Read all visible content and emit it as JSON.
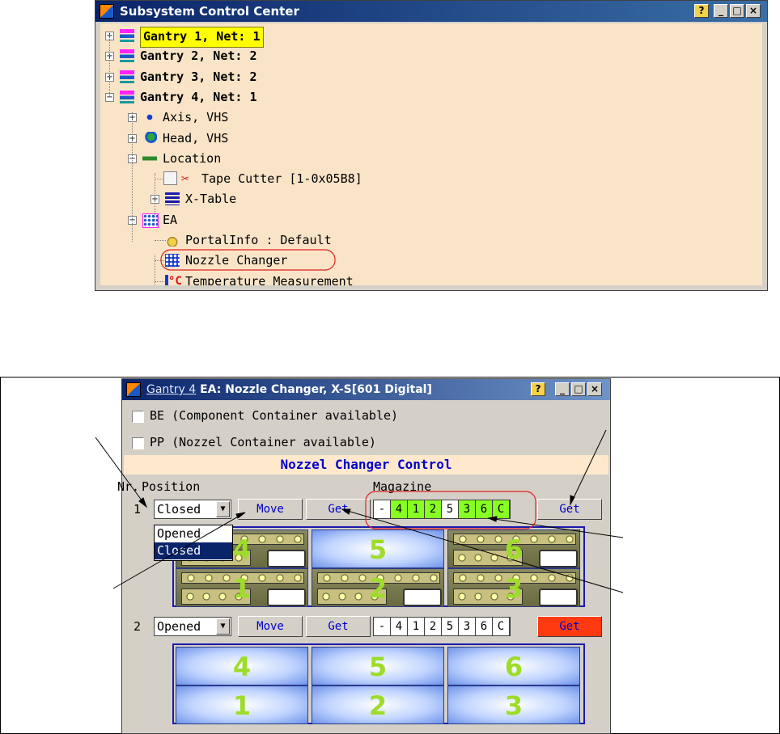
{
  "tree_window": {
    "title": "Subsystem Control Center",
    "nodes": [
      {
        "label": "Gantry 1, Net: 1",
        "bold": true,
        "highlight": true,
        "icon": "gantry-icon",
        "expander": "+"
      },
      {
        "label": "Gantry 2, Net: 2",
        "bold": true,
        "icon": "gantry-icon",
        "expander": "+"
      },
      {
        "label": "Gantry 3, Net: 2",
        "bold": true,
        "icon": "gantry-icon",
        "expander": "+"
      },
      {
        "label": "Gantry 4, Net: 1",
        "bold": true,
        "icon": "gantry-icon",
        "expander": "−"
      },
      {
        "label": "Axis, VHS",
        "icon": "axis-icon",
        "expander": "+"
      },
      {
        "label": "Head, VHS",
        "icon": "head-icon",
        "expander": "+"
      },
      {
        "label": "Location",
        "icon": "location-icon",
        "expander": "−"
      },
      {
        "label": "Tape Cutter [1-0x05B8]",
        "icon": "scissors-icon"
      },
      {
        "label": "X-Table",
        "icon": "x-table-icon",
        "expander": "+"
      },
      {
        "label": "EA",
        "icon": "ea-icon",
        "expander": "−"
      },
      {
        "label": "PortalInfo : Default",
        "icon": "portal-info-icon"
      },
      {
        "label": "Nozzle Changer",
        "icon": "nozzle-changer-icon",
        "circled": true
      },
      {
        "label": "Temperature Measurement",
        "icon": "temperature-icon",
        "icon_text": "°C"
      }
    ]
  },
  "nozzle_window": {
    "title_link": "Gantry 4",
    "title_rest": " EA: Nozzle Changer, X-S[601 Digital]",
    "checkboxes": [
      {
        "label": "BE (Component Container available)"
      },
      {
        "label": "PP (Nozzel Container available)"
      }
    ],
    "section_title": "Nozzel Changer Control",
    "col_nr": "Nr.",
    "col_position": "Position",
    "col_magazine": "Magazine",
    "rows": [
      {
        "nr": "1",
        "position": "Closed",
        "move_label": "Move",
        "get_label": "Get",
        "magazine": [
          "-",
          "4",
          "1",
          "2",
          "5",
          "3",
          "6",
          "C"
        ],
        "magazine_active": [
          false,
          true,
          true,
          true,
          false,
          true,
          true,
          true
        ],
        "get2_label": "Get",
        "dropdown_options": [
          "Opened",
          "Closed"
        ],
        "slots": [
          "4",
          "5",
          "6",
          "1",
          "2",
          "3"
        ]
      },
      {
        "nr": "2",
        "position": "Opened",
        "move_label": "Move",
        "get_label": "Get",
        "magazine": [
          "-",
          "4",
          "1",
          "2",
          "5",
          "3",
          "6",
          "C"
        ],
        "magazine_active": [
          false,
          false,
          false,
          false,
          false,
          false,
          false,
          false
        ],
        "get2_label": "Get",
        "slots": [
          "4",
          "5",
          "6",
          "1",
          "2",
          "3"
        ]
      }
    ]
  },
  "colors": {
    "tree_background": "#f9e4c8",
    "window_background": "#d4d0c8",
    "active_cell": "#88ff22",
    "slot_number": "#9edc2a",
    "highlight": "#ffff00",
    "red_button": "#ff3a10",
    "annotation_circle": "#e02020"
  }
}
